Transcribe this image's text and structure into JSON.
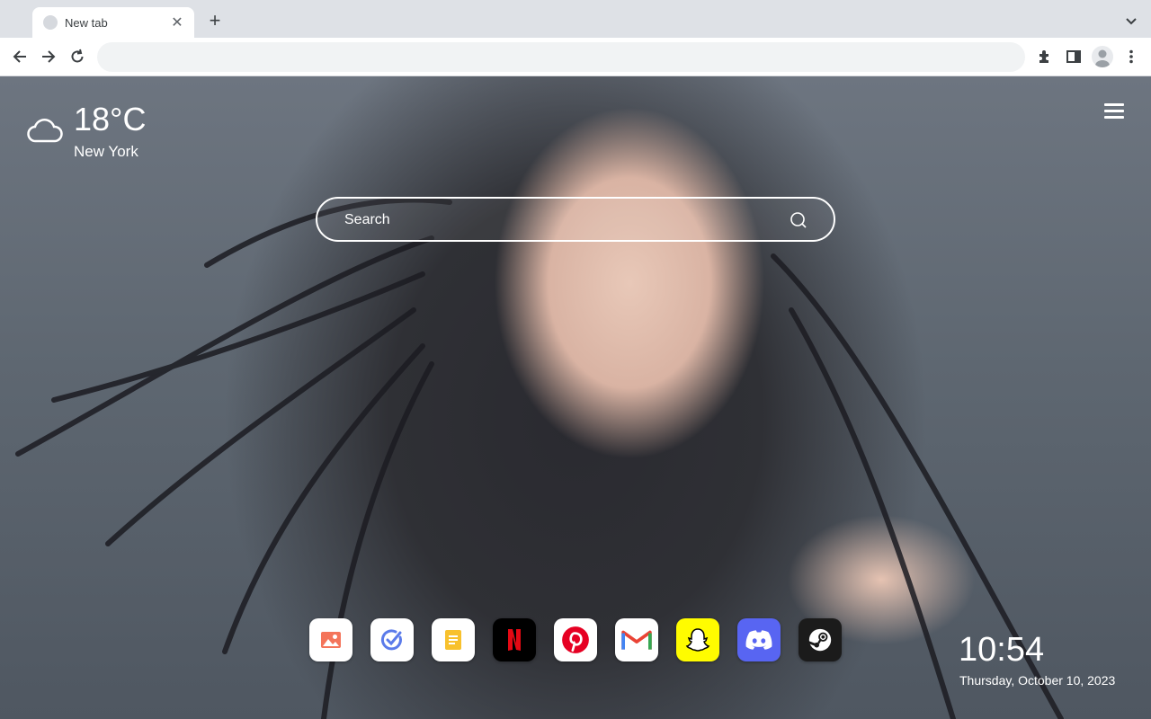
{
  "browser": {
    "tab_title": "New tab",
    "address_value": "",
    "address_placeholder": ""
  },
  "weather": {
    "temperature": "18°C",
    "city": "New York",
    "icon": "cloud-icon"
  },
  "search": {
    "placeholder": "Search"
  },
  "dock": {
    "apps": [
      {
        "name": "photos-app",
        "icon": "photo-icon",
        "bg": "#ffffff"
      },
      {
        "name": "todo-app",
        "icon": "check-circle-icon",
        "bg": "#ffffff"
      },
      {
        "name": "notes-app",
        "icon": "note-icon",
        "bg": "#ffffff"
      },
      {
        "name": "netflix-app",
        "icon": "netflix-icon",
        "bg": "#000000"
      },
      {
        "name": "pinterest-app",
        "icon": "pinterest-icon",
        "bg": "#ffffff"
      },
      {
        "name": "gmail-app",
        "icon": "gmail-icon",
        "bg": "#ffffff"
      },
      {
        "name": "snapchat-app",
        "icon": "snapchat-icon",
        "bg": "#fffc00"
      },
      {
        "name": "discord-app",
        "icon": "discord-icon",
        "bg": "#5865f2"
      },
      {
        "name": "steam-app",
        "icon": "steam-icon",
        "bg": "#1b1b1b"
      }
    ]
  },
  "clock": {
    "time": "10:54",
    "date": "Thursday, October 10, 2023"
  },
  "colors": {
    "netflix_red": "#e50914",
    "pinterest_red": "#e60023",
    "gmail_red": "#ea4335",
    "snapchat_yellow": "#fffc00",
    "discord_blurple": "#5865f2"
  }
}
